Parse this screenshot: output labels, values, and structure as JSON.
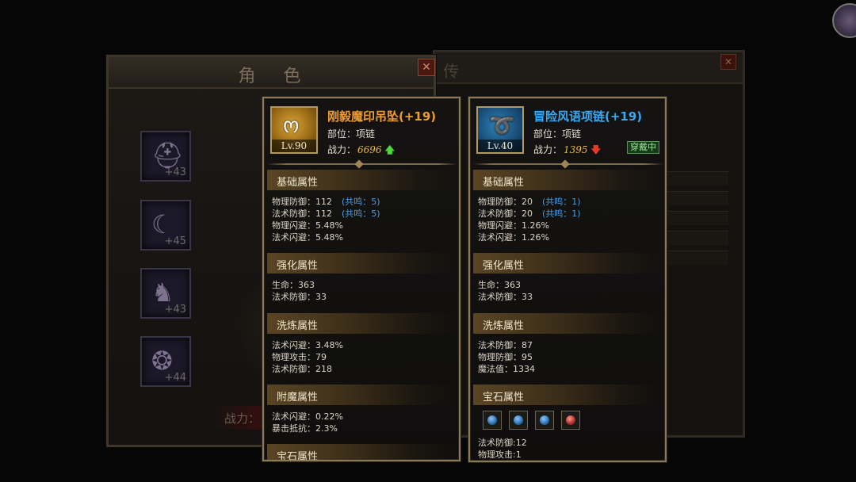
{
  "background": {
    "role_window_title": "角 色",
    "role_close": "✕",
    "power_label": "战力：",
    "right_window_title_fragment": "传",
    "right_window_close": "✕",
    "equip_slots": [
      {
        "icon": "helmet-icon",
        "glyph": "⛑",
        "plus": "+43"
      },
      {
        "icon": "necklace-icon",
        "glyph": "☾",
        "plus": "+45"
      },
      {
        "icon": "boots-icon",
        "glyph": "♞",
        "plus": "+43"
      },
      {
        "icon": "ring-icon",
        "glyph": "❂",
        "plus": "+44"
      }
    ]
  },
  "left_tip": {
    "name": "刚毅魔印吊坠(+19)",
    "level": "Lv.90",
    "part": "部位：项链",
    "power_label": "战力：",
    "power_value": "6696",
    "trend": "up",
    "sections": {
      "base_title": "基础属性",
      "base": [
        {
          "text": "物理防御：112",
          "reso": "(共鸣：5)"
        },
        {
          "text": "法术防御：112",
          "reso": "(共鸣：5)"
        },
        {
          "text": "物理闪避：5.48%",
          "reso": ""
        },
        {
          "text": "法术闪避：5.48%",
          "reso": ""
        }
      ],
      "enhance_title": "强化属性",
      "enhance": [
        "生命：363",
        "法术防御：33"
      ],
      "refine_title": "洗炼属性",
      "refine": [
        "法术闪避：3.48%",
        "物理攻击：79",
        "法术防御：218"
      ],
      "enchant_title": "附魔属性",
      "enchant": [
        "法术闪避：0.22%",
        "暴击抵抗：2.3%"
      ],
      "gem_title": "宝石属性"
    }
  },
  "right_tip": {
    "name": "冒险风语项链(+19)",
    "level": "Lv.40",
    "part": "部位：项链",
    "power_label": "战力：",
    "power_value": "1395",
    "trend": "down",
    "equipped_badge": "穿戴中",
    "sections": {
      "base_title": "基础属性",
      "base": [
        {
          "text": "物理防御：20",
          "reso": "(共鸣：1)"
        },
        {
          "text": "法术防御：20",
          "reso": "(共鸣：1)"
        },
        {
          "text": "物理闪避：1.26%",
          "reso": ""
        },
        {
          "text": "法术闪避：1.26%",
          "reso": ""
        }
      ],
      "enhance_title": "强化属性",
      "enhance": [
        "生命：363",
        "法术防御：33"
      ],
      "refine_title": "洗炼属性",
      "refine": [
        "法术防御：87",
        "物理防御：95",
        "魔法值：1334"
      ],
      "gem_title": "宝石属性",
      "gems": [
        "blue-gem-icon",
        "blue-gem-icon",
        "blue-gem-icon",
        "red-gem-icon"
      ],
      "gem_attrs": [
        "法术防御:12",
        "物理攻击:1"
      ]
    }
  },
  "colors": {
    "orange_name": "#ef9c2e",
    "blue_name": "#3aa8f0",
    "power_value": "#e8b84a",
    "resonance": "#4a9ee6",
    "up_arrow": "#4cd83a",
    "down_arrow": "#e83a2a"
  }
}
